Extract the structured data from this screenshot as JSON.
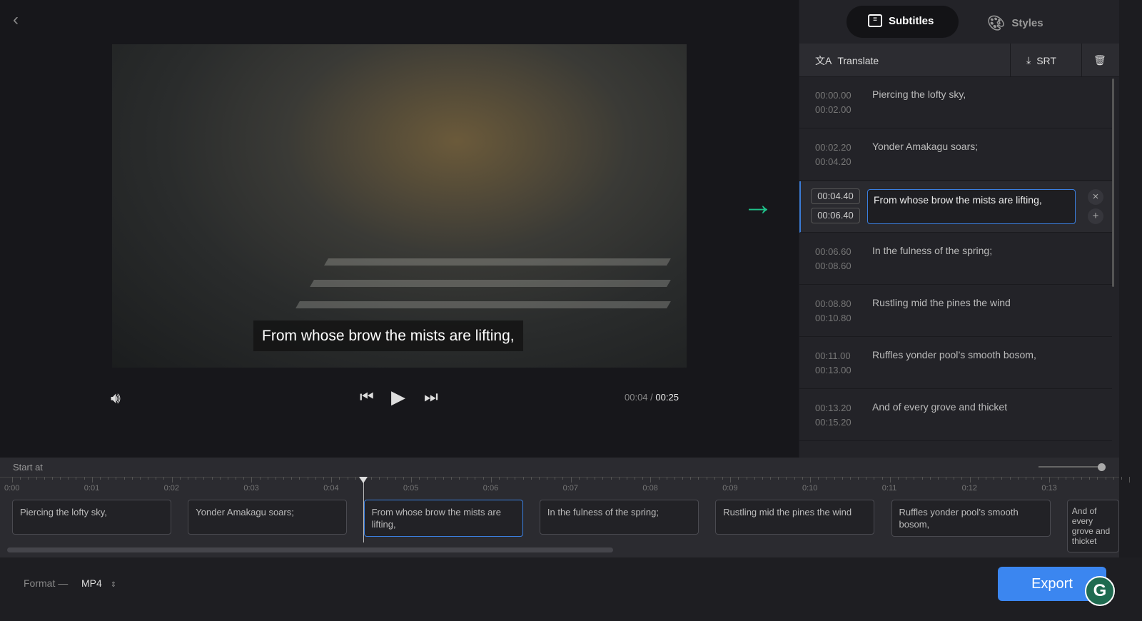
{
  "player": {
    "caption": "From whose brow the mists are lifting,",
    "current_time": "00:04",
    "separator": "/",
    "duration": "00:25"
  },
  "panel": {
    "tabs": [
      {
        "label": "Subtitles",
        "active": true
      },
      {
        "label": "Styles",
        "active": false
      }
    ],
    "toolbar": {
      "translate": "Translate",
      "srt": "SRT"
    },
    "subtitles": [
      {
        "start": "00:00.00",
        "end": "00:02.00",
        "text": "Piercing the lofty sky,"
      },
      {
        "start": "00:02.20",
        "end": "00:04.20",
        "text": "Yonder Amakagu soars;"
      },
      {
        "start": "00:04.40",
        "end": "00:06.40",
        "text": "From whose brow the mists are lifting,"
      },
      {
        "start": "00:06.60",
        "end": "00:08.60",
        "text": "In the fulness of the spring;"
      },
      {
        "start": "00:08.80",
        "end": "00:10.80",
        "text": "Rustling mid the pines the wind"
      },
      {
        "start": "00:11.00",
        "end": "00:13.00",
        "text": "Ruffles yonder pool’s smooth bosom,"
      },
      {
        "start": "00:13.20",
        "end": "00:15.20",
        "text": "And of every grove and thicket"
      }
    ]
  },
  "timeline": {
    "start_label": "Start at",
    "ticks": [
      "0:00",
      "0:01",
      "0:02",
      "0:03",
      "0:04",
      "0:05",
      "0:06",
      "0:07",
      "0:08",
      "0:09",
      "0:10",
      "0:11",
      "0:12",
      "0:13"
    ],
    "clips": [
      "Piercing the lofty sky,",
      "Yonder Amakagu soars;",
      "From whose brow the mists are lifting,",
      "In the fulness of the spring;",
      "Rustling mid the pines the wind",
      "Ruffles yonder pool’s smooth bosom,",
      "And of every grove and thicket"
    ],
    "playhead_seconds": 4.4,
    "zoom_level": 0.95
  },
  "footer": {
    "format_label": "Format —",
    "format_value": "MP4",
    "export": "Export"
  },
  "colors": {
    "accent": "#3b86f0",
    "arrow": "#1fc28a"
  }
}
